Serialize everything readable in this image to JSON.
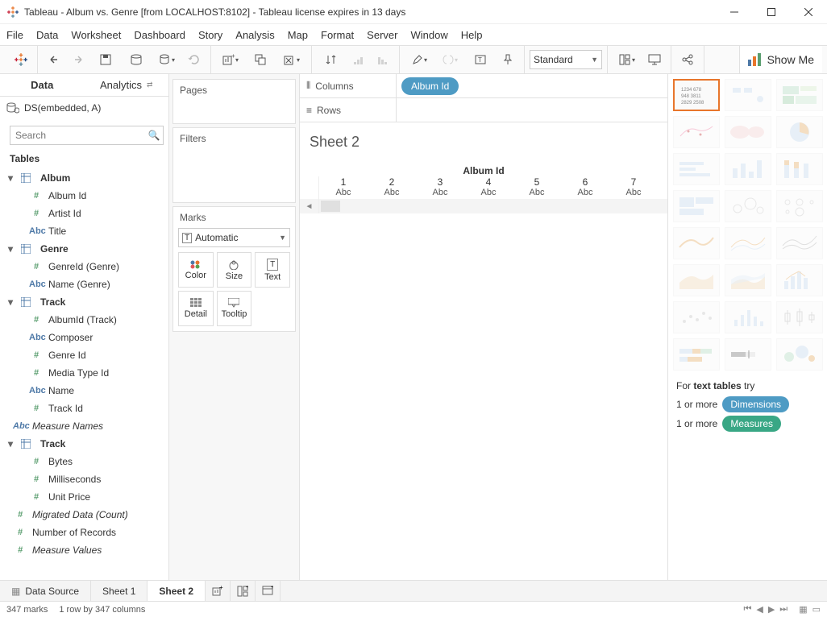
{
  "window": {
    "title": "Tableau - Album vs. Genre [from LOCALHOST:8102] - Tableau license expires in 13 days"
  },
  "menu": [
    "File",
    "Data",
    "Worksheet",
    "Dashboard",
    "Story",
    "Analysis",
    "Map",
    "Format",
    "Server",
    "Window",
    "Help"
  ],
  "toolbar": {
    "fit": "Standard",
    "showme": "Show Me"
  },
  "sidebar": {
    "tabs": [
      "Data",
      "Analytics"
    ],
    "datasource": "DS(embedded, A)",
    "search_placeholder": "Search",
    "tables_header": "Tables",
    "groups": [
      {
        "name": "Album",
        "fields": [
          {
            "icon": "#",
            "label": "Album Id",
            "cls": "ic-num"
          },
          {
            "icon": "#",
            "label": "Artist Id",
            "cls": "ic-num"
          },
          {
            "icon": "Abc",
            "label": "Title",
            "cls": "ic-str"
          }
        ]
      },
      {
        "name": "Genre",
        "fields": [
          {
            "icon": "#",
            "label": "GenreId (Genre)",
            "cls": "ic-num"
          },
          {
            "icon": "Abc",
            "label": "Name (Genre)",
            "cls": "ic-str"
          }
        ]
      },
      {
        "name": "Track",
        "fields": [
          {
            "icon": "#",
            "label": "AlbumId (Track)",
            "cls": "ic-num"
          },
          {
            "icon": "Abc",
            "label": "Composer",
            "cls": "ic-str"
          },
          {
            "icon": "#",
            "label": "Genre Id",
            "cls": "ic-num"
          },
          {
            "icon": "#",
            "label": "Media Type Id",
            "cls": "ic-num"
          },
          {
            "icon": "Abc",
            "label": "Name",
            "cls": "ic-str"
          },
          {
            "icon": "#",
            "label": "Track Id",
            "cls": "ic-num"
          }
        ]
      }
    ],
    "measure_names": "Measure Names",
    "measures_group": {
      "name": "Track",
      "fields": [
        {
          "icon": "#",
          "label": "Bytes",
          "cls": "ic-num"
        },
        {
          "icon": "#",
          "label": "Milliseconds",
          "cls": "ic-num"
        },
        {
          "icon": "#",
          "label": "Unit Price",
          "cls": "ic-num"
        }
      ]
    },
    "extras": [
      {
        "icon": "#",
        "label": "Migrated Data (Count)",
        "italic": true,
        "cls": "ic-num"
      },
      {
        "icon": "#",
        "label": "Number of Records",
        "cls": "ic-num"
      },
      {
        "icon": "#",
        "label": "Measure Values",
        "italic": true,
        "cls": "ic-num"
      }
    ]
  },
  "shelves": {
    "pages": "Pages",
    "filters": "Filters",
    "marks": "Marks",
    "marktype": "Automatic",
    "mark_buttons": [
      "Color",
      "Size",
      "Text",
      "Detail",
      "Tooltip"
    ]
  },
  "view": {
    "columns_label": "Columns",
    "rows_label": "Rows",
    "columns_pill": "Album Id",
    "sheet_title": "Sheet 2",
    "header_title": "Album Id",
    "cols": [
      "1",
      "2",
      "3",
      "4",
      "5",
      "6",
      "7"
    ],
    "abc": "Abc"
  },
  "showme": {
    "hint_pre": "For ",
    "hint_bold": "text tables",
    "hint_post": " try",
    "one_or_more": "1 or more",
    "dimensions": "Dimensions",
    "measures": "Measures"
  },
  "bottom": {
    "datasource": "Data Source",
    "sheet1": "Sheet 1",
    "sheet2": "Sheet 2"
  },
  "status": {
    "marks": "347 marks",
    "rowcol": "1 row by 347 columns"
  }
}
